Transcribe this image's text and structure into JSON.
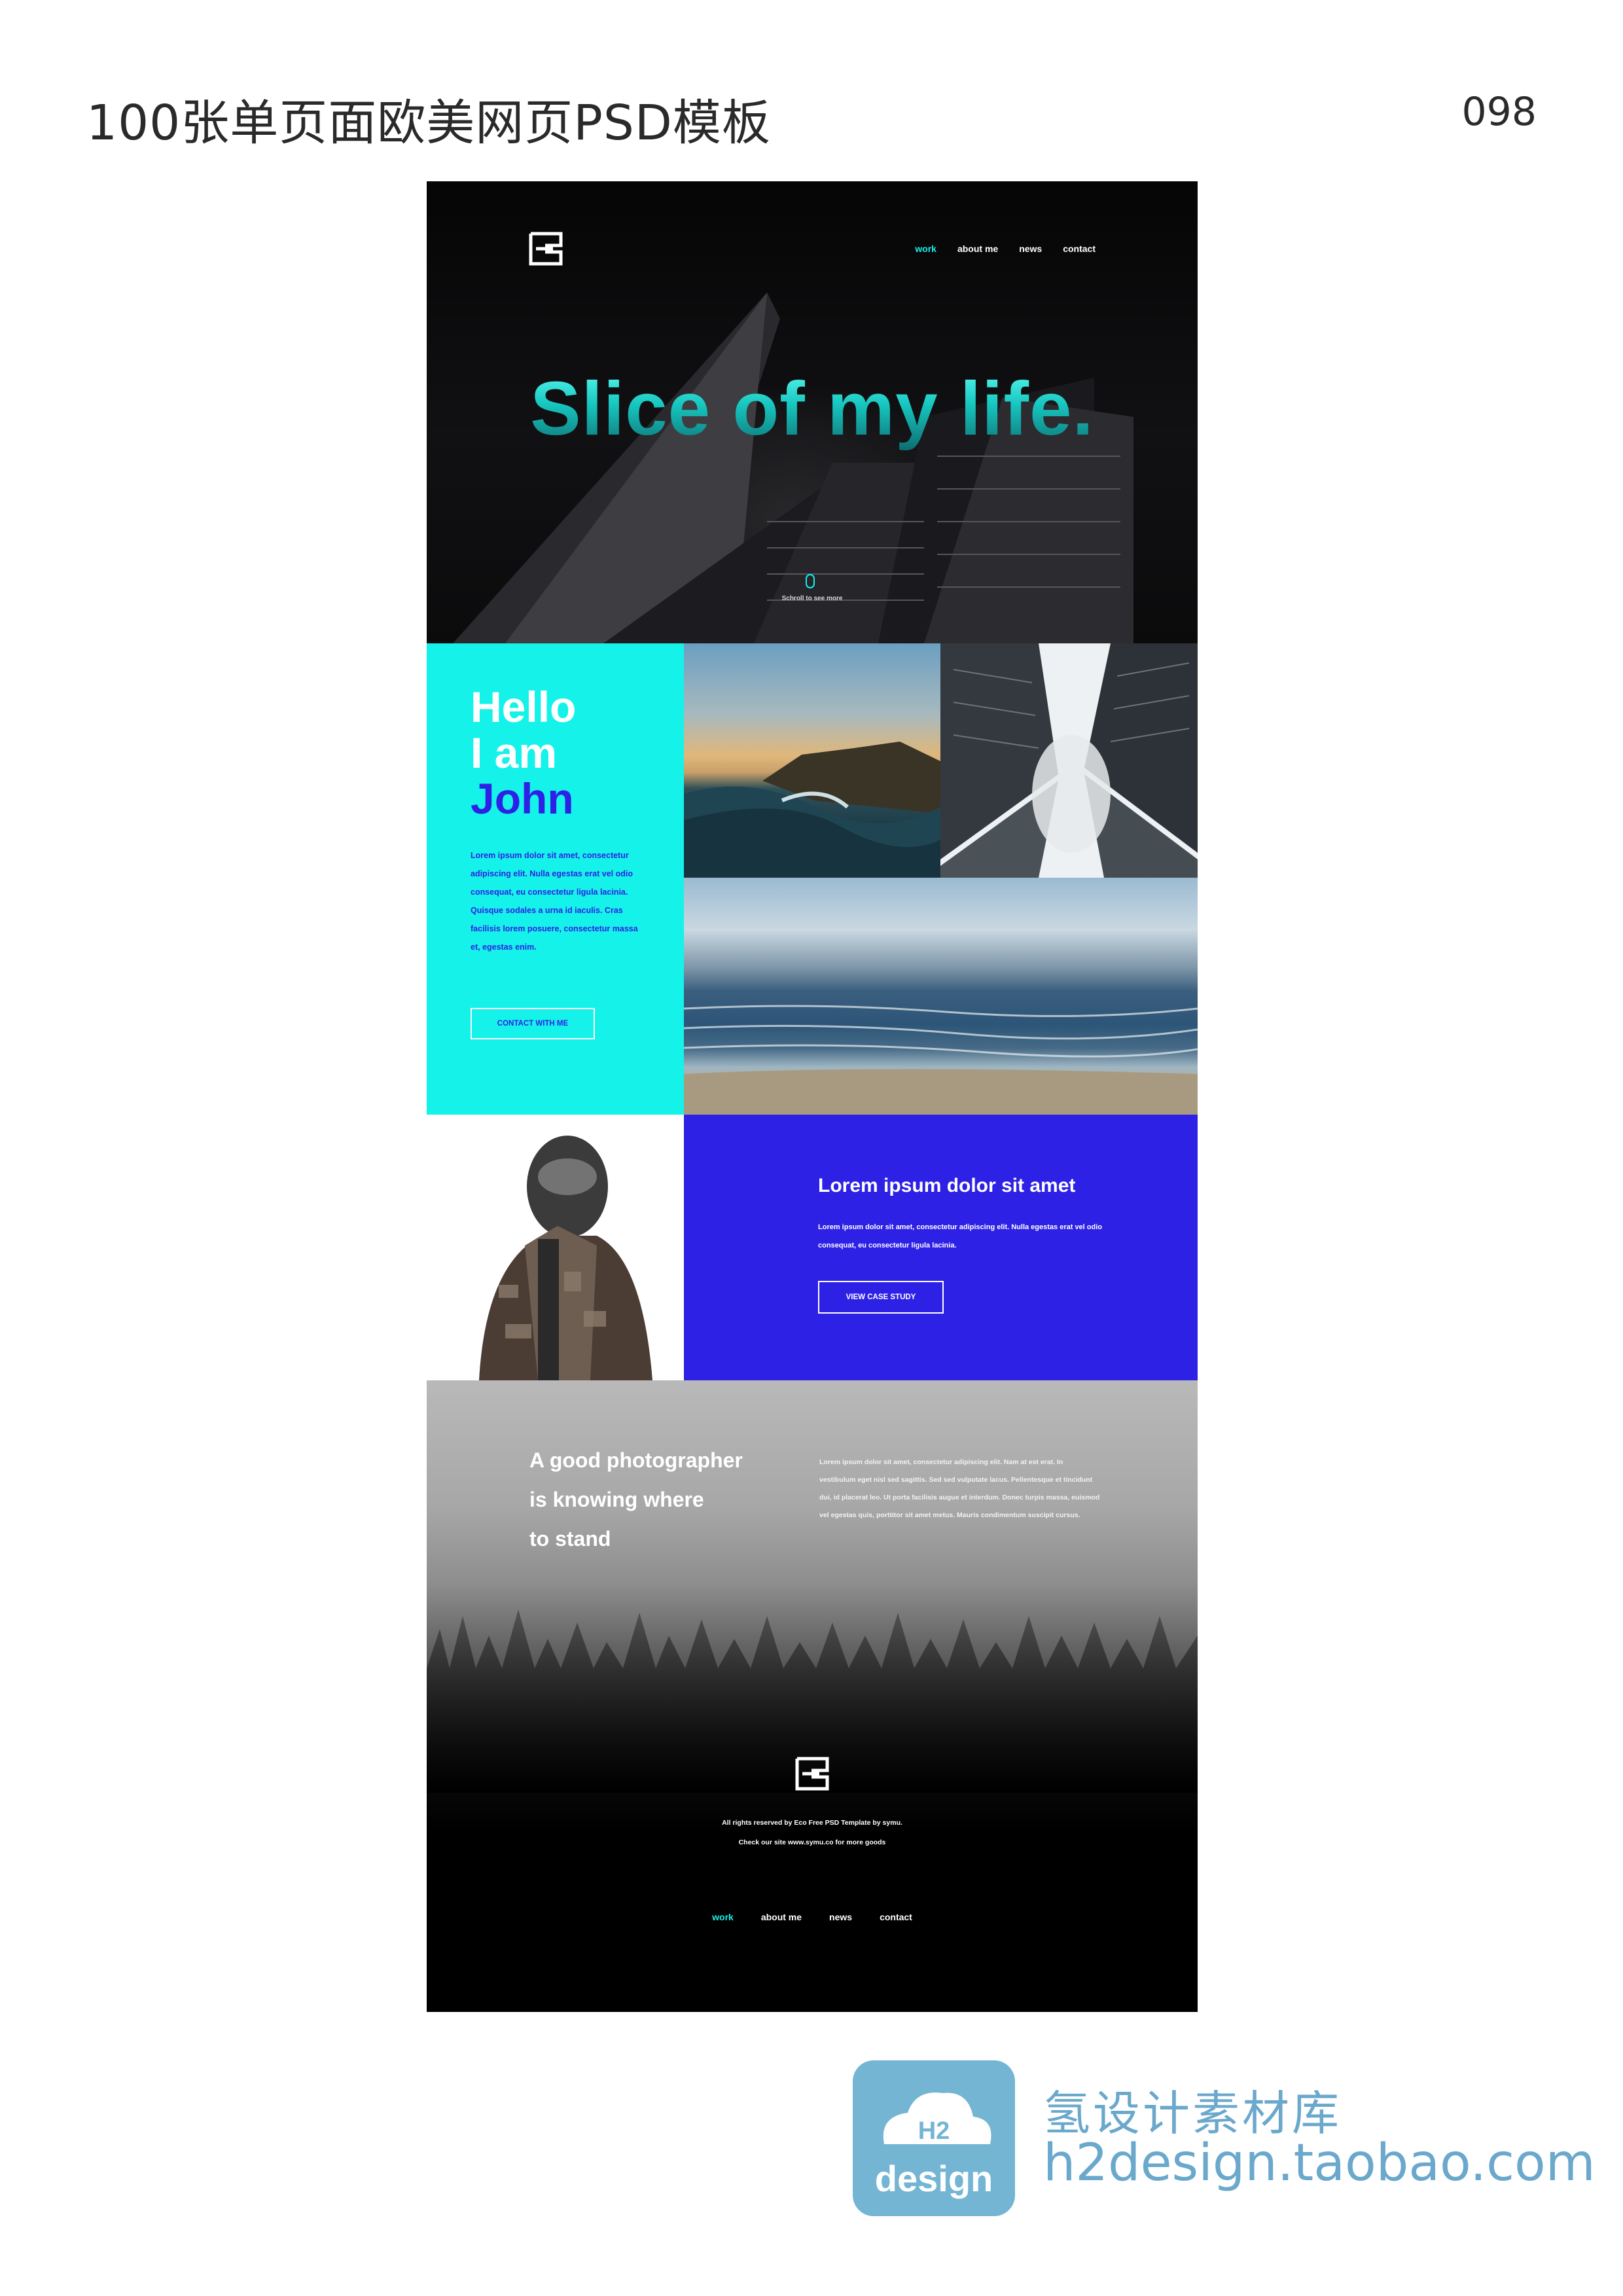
{
  "sheet": {
    "title": "100张单页面欧美网页PSD模板",
    "number": "098"
  },
  "colors": {
    "accent_cyan": "#15f2ea",
    "accent_blue": "#2e21e6",
    "black": "#000000",
    "watermark_blue": "#74b5d3"
  },
  "header": {
    "logo_icon": "e-logo-icon",
    "nav": [
      {
        "label": "work",
        "active": true
      },
      {
        "label": "about me",
        "active": false
      },
      {
        "label": "news",
        "active": false
      },
      {
        "label": "contact",
        "active": false
      }
    ]
  },
  "hero": {
    "title": "Slice of my life.",
    "scroll_icon": "mouse-icon",
    "scroll_text": "Schroll to see more"
  },
  "intro": {
    "line1": "Hello",
    "line2": "I am",
    "name": "John",
    "body": "Lorem ipsum dolor sit amet, consectetur adipiscing elit. Nulla egestas erat vel odio consequat, eu consectetur ligula lacinia. Quisque sodales a urna id iaculis. Cras facilisis lorem posuere, consectetur massa et, egestas enim.",
    "button": "CONTACT WITH ME"
  },
  "case_study": {
    "heading": "Lorem ipsum dolor sit amet",
    "body": "Lorem ipsum dolor sit amet, consectetur adipiscing elit. Nulla egestas erat vel odio consequat, eu consectetur ligula lacinia.",
    "button": "VIEW CASE STUDY"
  },
  "quote_section": {
    "quote_lines": [
      "A good photographer",
      "is knowing where",
      "to stand"
    ],
    "body": "Lorem ipsum dolor sit amet, consectetur adipiscing elit. Nam at est erat. In vestibulum eget nisl sed sagittis. Sed sed vulputate lacus. Pellentesque et tincidunt dui, id placerat leo. Ut porta facilisis augue et interdum. Donec turpis massa, euismod vel egestas quis, porttitor sit amet metus. Mauris condimentum suscipit cursus."
  },
  "footer": {
    "logo_icon": "e-logo-icon",
    "copyright": "All rights reserved by Eco Free PSD Template by symu.",
    "site_note": "Check our site www.symu.co for more goods",
    "nav": [
      {
        "label": "work",
        "active": true
      },
      {
        "label": "about me",
        "active": false
      },
      {
        "label": "news",
        "active": false
      },
      {
        "label": "contact",
        "active": false
      }
    ]
  },
  "watermark": {
    "badge_letters": "H2",
    "badge_text": "design",
    "chinese": "氢设计素材库",
    "url": "h2design.taobao.com"
  }
}
